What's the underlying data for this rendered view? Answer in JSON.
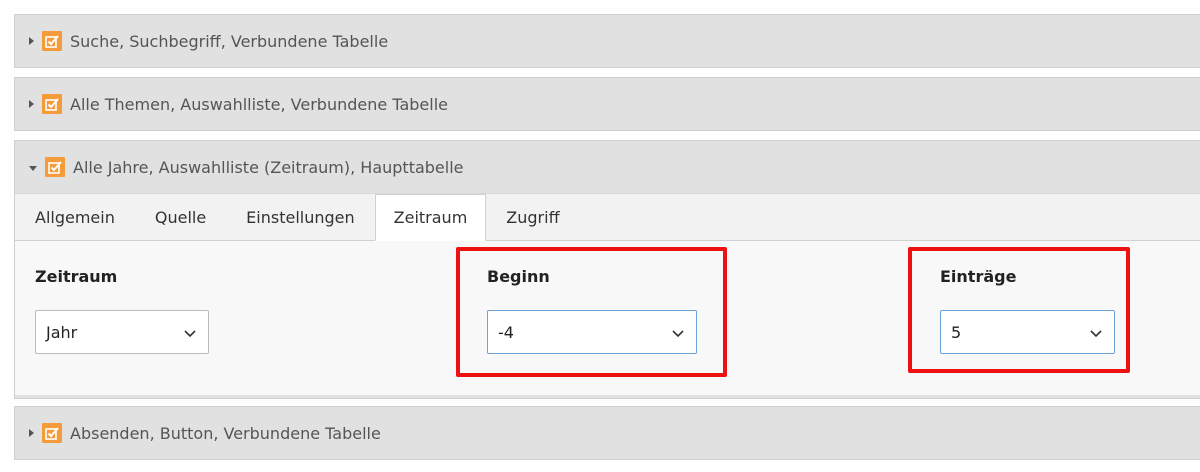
{
  "panels": [
    {
      "title": "Suche, Suchbegriff, Verbundene Tabelle"
    },
    {
      "title": "Alle Themen, Auswahlliste, Verbundene Tabelle"
    },
    {
      "title": "Alle Jahre, Auswahlliste (Zeitraum), Haupttabelle"
    },
    {
      "title": "Absenden, Button, Verbundene Tabelle"
    }
  ],
  "tabs": [
    "Allgemein",
    "Quelle",
    "Einstellungen",
    "Zeitraum",
    "Zugriff"
  ],
  "active_tab": "Zeitraum",
  "fields": {
    "zeitraum": {
      "label": "Zeitraum",
      "value": "Jahr"
    },
    "beginn": {
      "label": "Beginn",
      "value": "-4"
    },
    "eintraege": {
      "label": "Einträge",
      "value": "5"
    }
  },
  "colors": {
    "checkbox_icon": "#f49c39",
    "highlight": "#ee1111",
    "focus_border": "#6fa3d8"
  }
}
